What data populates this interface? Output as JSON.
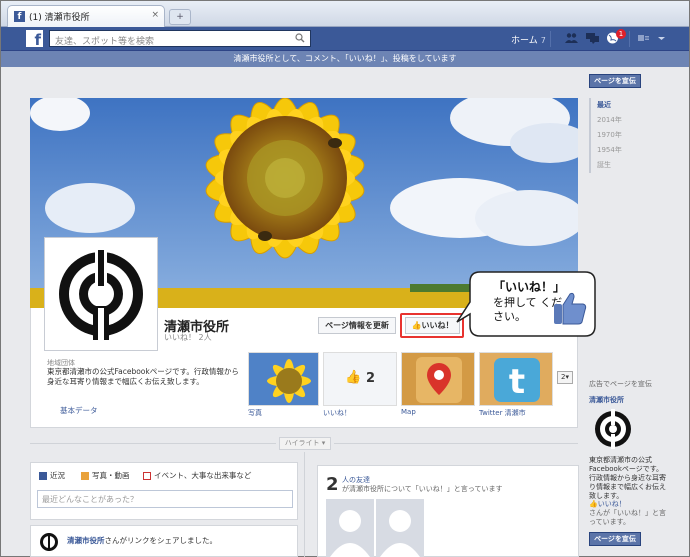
{
  "browser": {
    "tab_title": "(1) 清瀬市役所",
    "close": "×",
    "new_tab": "+"
  },
  "topbar": {
    "search_placeholder": "友達、スポット等を検索",
    "home_label": "ホーム",
    "home_count": "7",
    "notification_count": "1"
  },
  "notice": "清瀬市役所として、コメント、「いいね！」、投稿をしています",
  "page": {
    "name": "清瀬市役所",
    "likes": "いいね！ 2人",
    "update_button": "ページ情報を更新",
    "like_button": "いいね！",
    "about_label": "地域団体",
    "about_desc": "東京都清瀬市の公式Facebookページです。行政情報から身近な耳寄り情報まで幅広くお伝え致します。",
    "basic_data": "基本データ",
    "tiles": [
      {
        "label": "写真"
      },
      {
        "label": "いいね！",
        "count": "2"
      },
      {
        "label": "Map"
      },
      {
        "label": "Twitter 清瀬市"
      }
    ],
    "more_count": "2"
  },
  "highlight": "ハイライト ▾",
  "composer": {
    "tabs": [
      "近況",
      "写真・動画",
      "イベント、大事な出来事など"
    ],
    "placeholder": "最近どんなことがあった？"
  },
  "post": {
    "actor": "清瀬市役所",
    "text": "さんがリンクをシェアしました。"
  },
  "friends": {
    "count": "2",
    "title": "人の友達",
    "sub": "が清瀬市役所について「いいね！」と言っています"
  },
  "rail": {
    "promote_button": "ページを宣伝",
    "timeline": [
      "最近",
      "2014年",
      "1970年",
      "1954年",
      "誕生"
    ],
    "ad_heading": "広告でページを宣伝",
    "ad_name": "清瀬市役所",
    "ad_desc": "東京都清瀬市の公式Facebookページです。行政情報から身近な耳寄り情報まで幅広くお伝え致します。",
    "ad_like_link": "いいね！",
    "ad_like_text": "さんが「いいね！」と言っています。",
    "ad_promote_button": "ページを宣伝"
  },
  "callout": {
    "line1": "「いいね！」",
    "line2": "を押して ください。"
  },
  "colors": {
    "facebook_blue": "#3b5998",
    "highlight_red": "#e8332f",
    "sunflower": "#f5c400",
    "sky": "#4f82c7"
  }
}
